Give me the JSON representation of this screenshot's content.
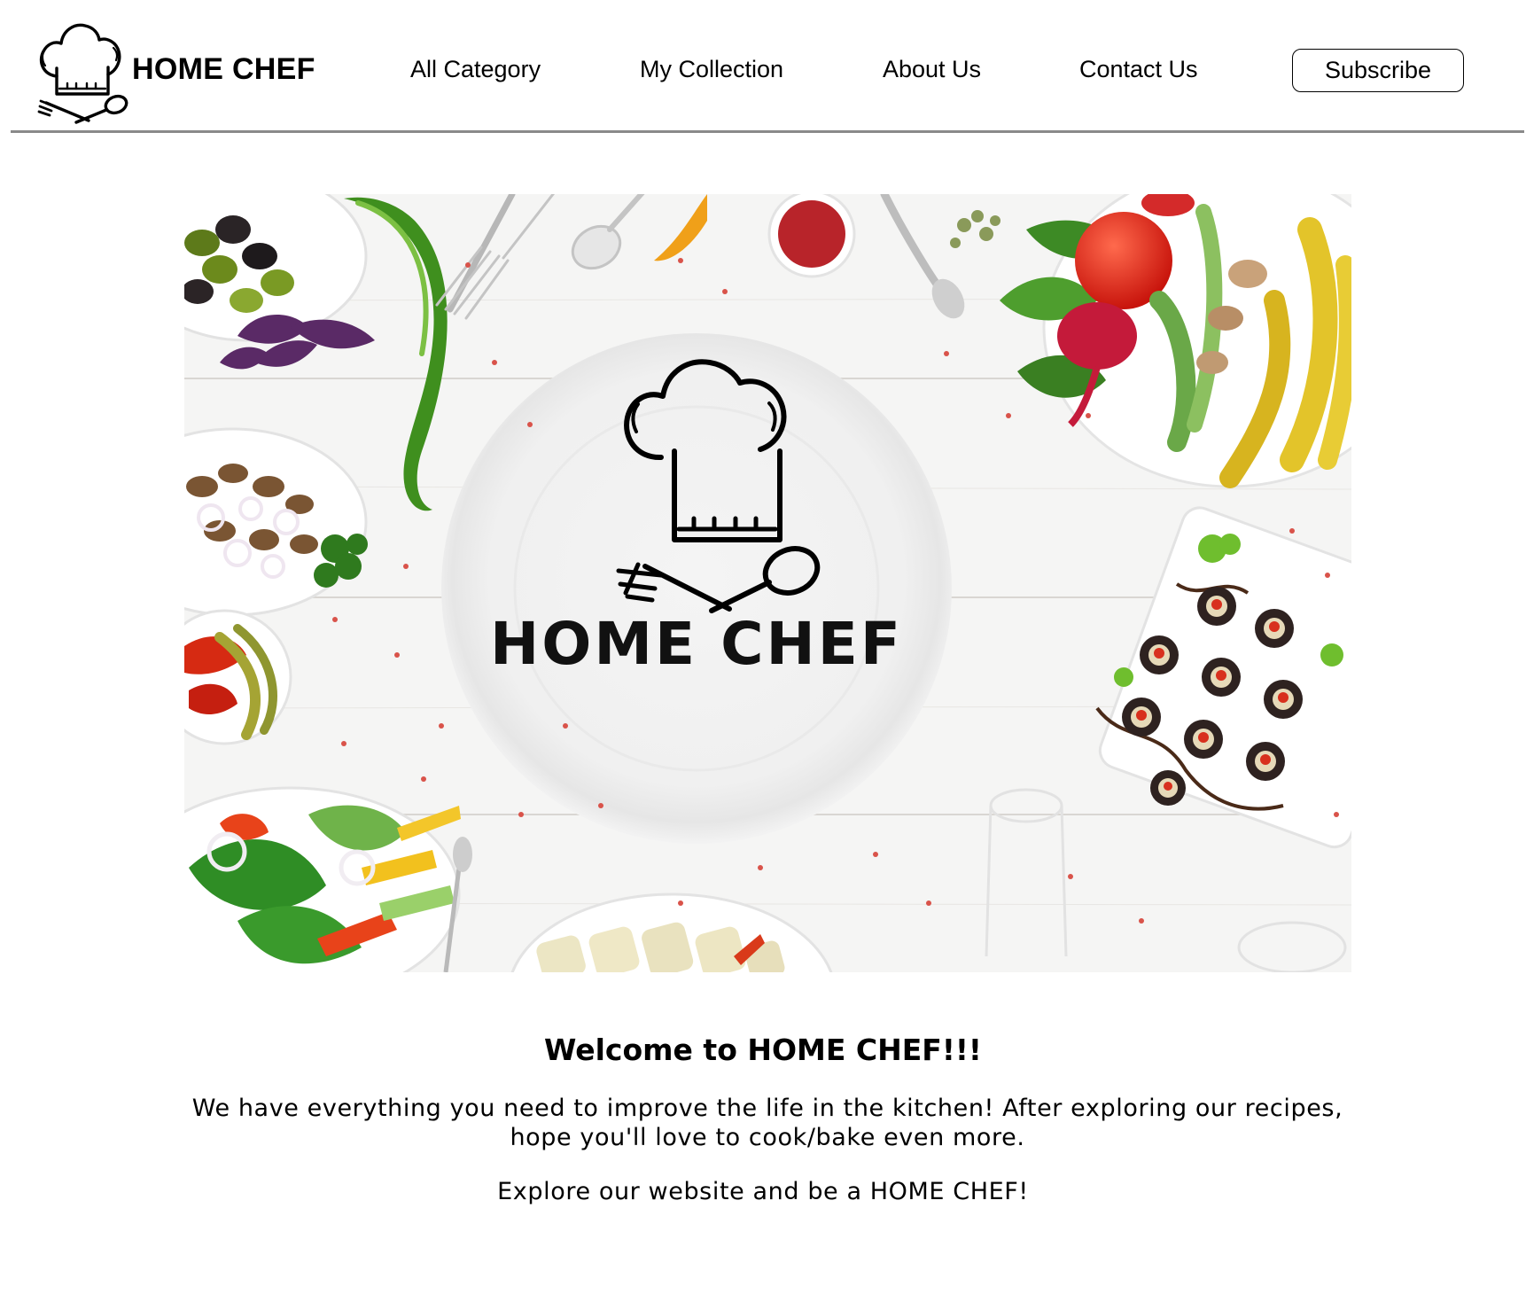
{
  "header": {
    "brand": "HOME CHEF",
    "logo_icon": "chef-hat-fork-spoon-icon",
    "nav": {
      "all_category": "All Category",
      "my_collection": "My Collection",
      "about_us": "About Us",
      "contact_us": "Contact Us"
    },
    "subscribe_label": "Subscribe"
  },
  "hero": {
    "logo_text": "HOME CHEF",
    "logo_icon": "chef-hat-fork-spoon-icon"
  },
  "intro": {
    "welcome": "Welcome to HOME CHEF!!!",
    "description": "We have everything you need to improve the life in the kitchen! After exploring our recipes, hope you'll love to cook/bake even more.",
    "tagline": "Explore our website and be a HOME CHEF!"
  },
  "colors": {
    "text": "#000000",
    "header_rule": "#8a8a8a",
    "hero_background": "#f4f4f4"
  }
}
